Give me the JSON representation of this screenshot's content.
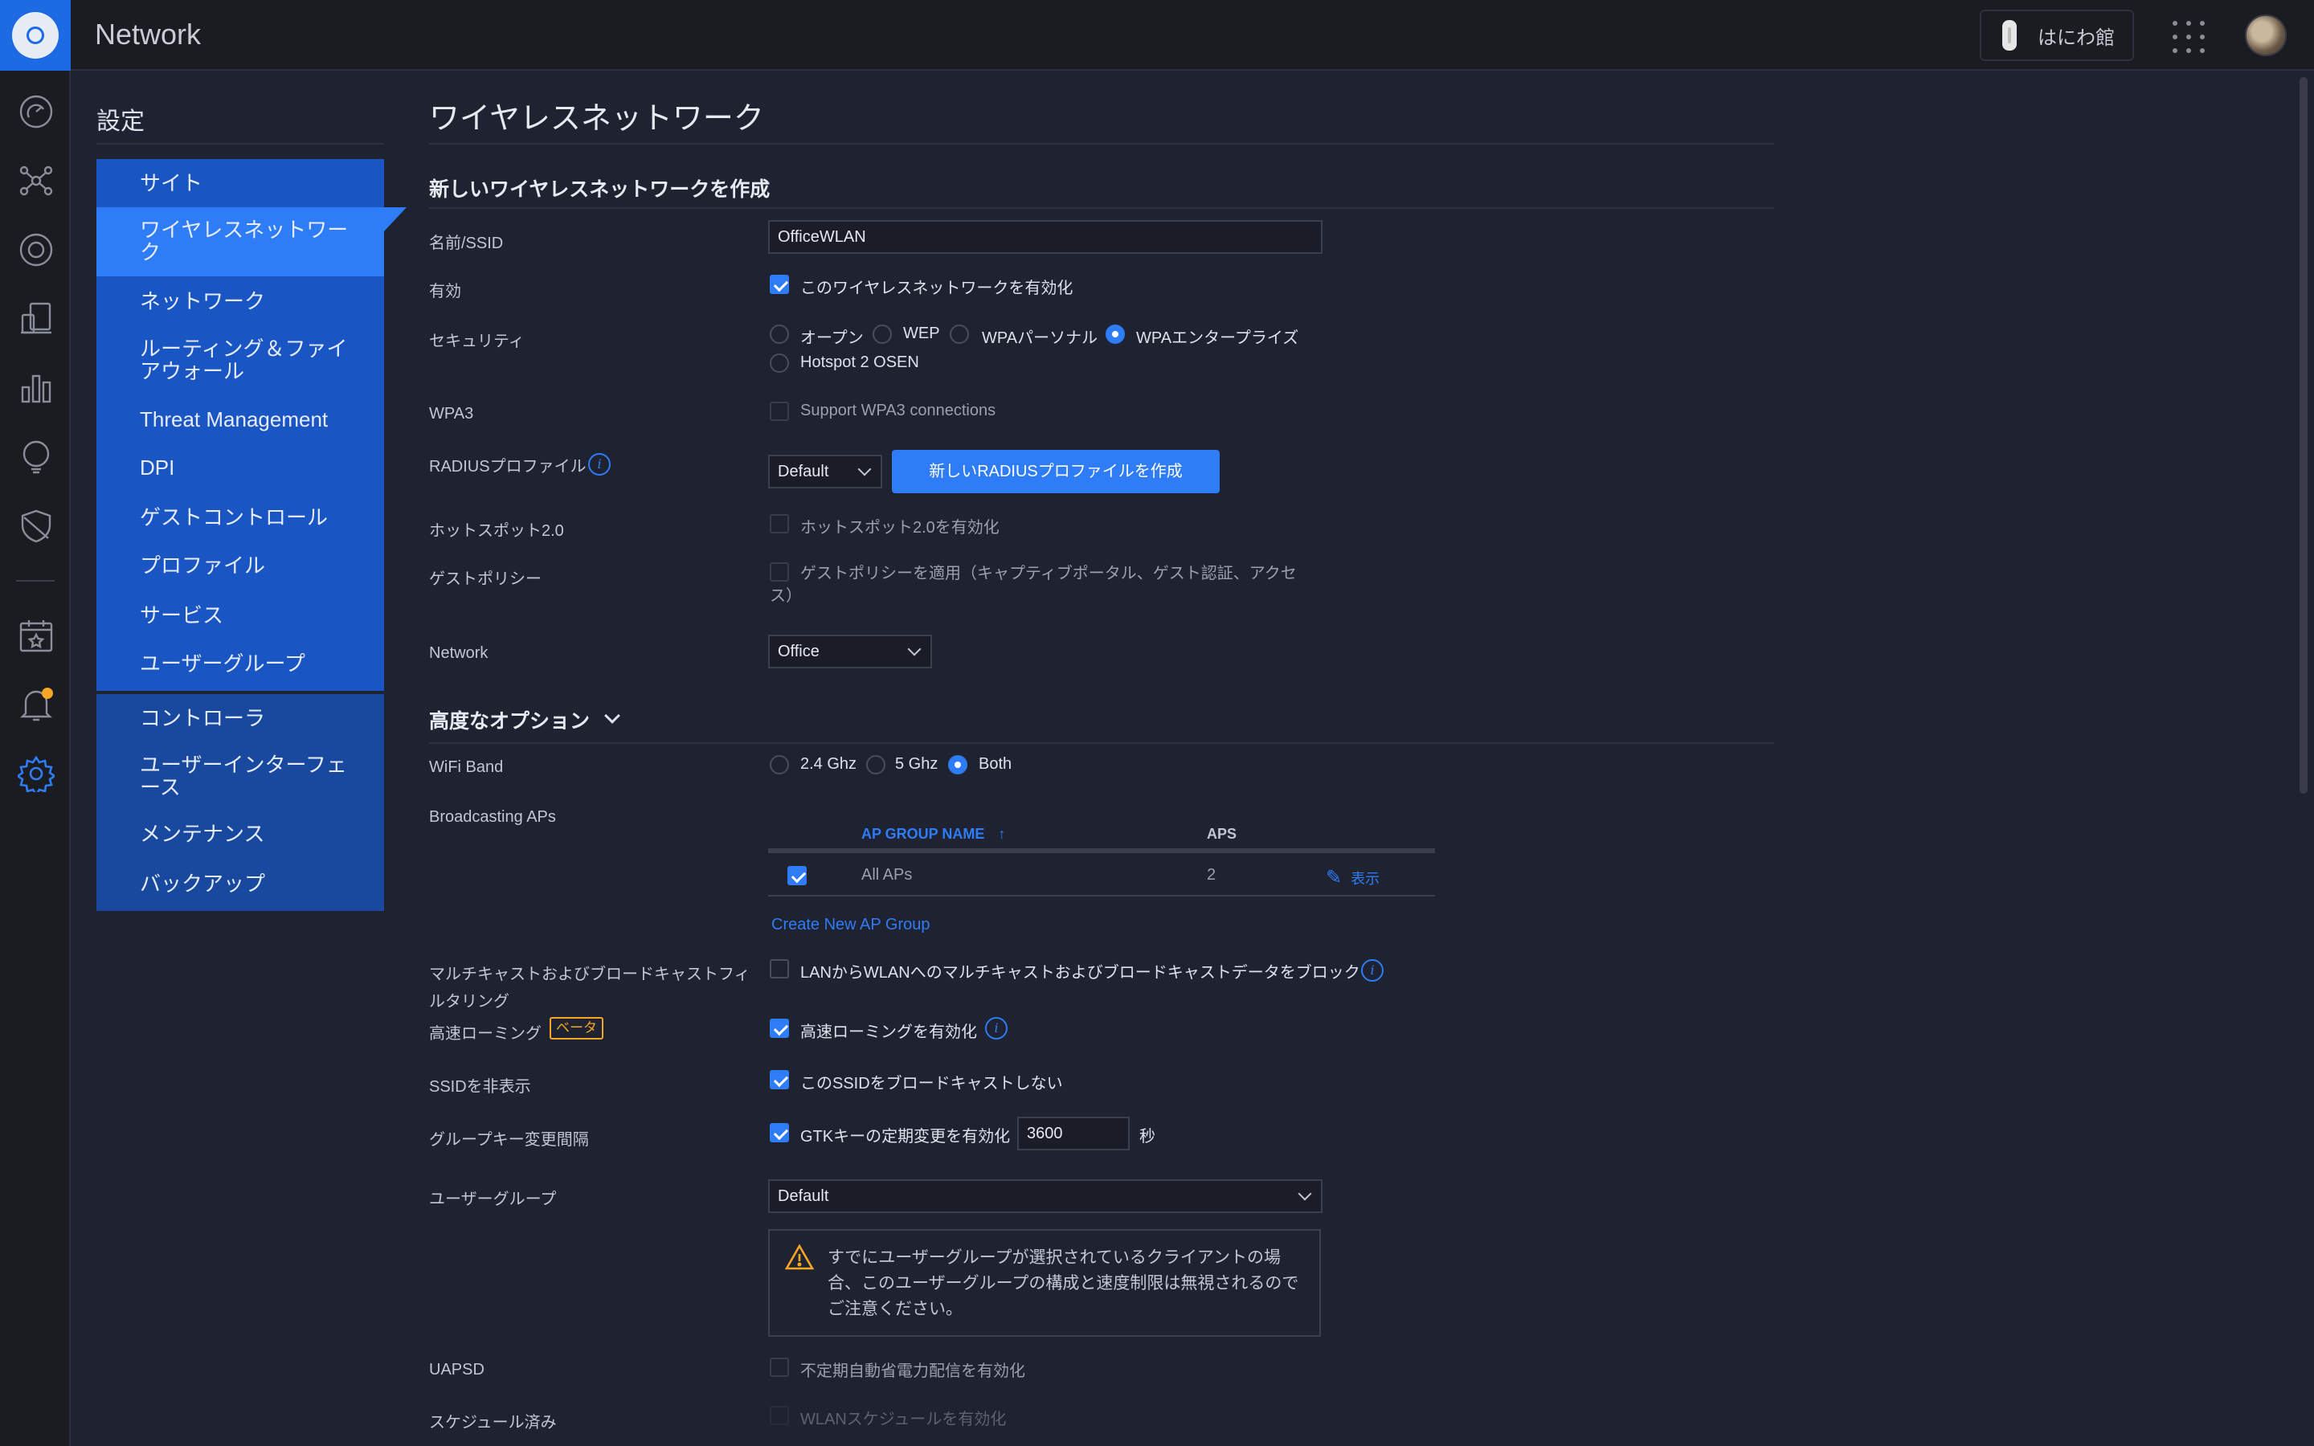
{
  "header": {
    "app_title": "Network",
    "site_name": "はにわ館",
    "icons": [
      "ubiquiti-logo-icon",
      "device-icon",
      "apps-grid-icon",
      "user-avatar"
    ]
  },
  "rail": {
    "items": [
      {
        "name": "dashboard-icon"
      },
      {
        "name": "topology-icon"
      },
      {
        "name": "devices-icon"
      },
      {
        "name": "clients-icon"
      },
      {
        "name": "statistics-icon"
      },
      {
        "name": "insights-icon"
      },
      {
        "name": "threat-shield-icon"
      },
      {
        "name": "events-calendar-icon"
      },
      {
        "name": "alerts-bell-icon"
      },
      {
        "name": "settings-gear-icon"
      }
    ]
  },
  "settings_nav": {
    "title": "設定",
    "group1": [
      {
        "label": "サイト"
      },
      {
        "label": "ワイヤレスネットワーク",
        "active": true
      },
      {
        "label": "ネットワーク"
      },
      {
        "label": "ルーティング＆ファイアウォール"
      },
      {
        "label": "Threat Management"
      },
      {
        "label": "DPI"
      },
      {
        "label": "ゲストコントロール"
      },
      {
        "label": "プロファイル"
      },
      {
        "label": "サービス"
      },
      {
        "label": "ユーザーグループ"
      }
    ],
    "group2": [
      {
        "label": "コントローラ"
      },
      {
        "label": "ユーザーインターフェース"
      },
      {
        "label": "メンテナンス"
      },
      {
        "label": "バックアップ"
      }
    ]
  },
  "main": {
    "page_title": "ワイヤレスネットワーク",
    "section_create": "新しいワイヤレスネットワークを作成",
    "name_label": "名前/SSID",
    "name_value": "OfficeWLAN",
    "enabled_label": "有効",
    "enabled_checkbox": "このワイヤレスネットワークを有効化",
    "security_label": "セキュリティ",
    "security_options": [
      "オープン",
      "WEP",
      "WPAパーソナル",
      "WPAエンタープライズ",
      "Hotspot 2 OSEN"
    ],
    "security_selected": "WPAエンタープライズ",
    "wpa3_label": "WPA3",
    "wpa3_checkbox": "Support WPA3 connections",
    "radius_label": "RADIUSプロファイル",
    "radius_value": "Default",
    "radius_button": "新しいRADIUSプロファイルを作成",
    "hotspot_label": "ホットスポット2.0",
    "hotspot_checkbox": "ホットスポット2.0を有効化",
    "guest_label": "ゲストポリシー",
    "guest_checkbox": "ゲストポリシーを適用（キャプティブポータル、ゲスト認証、アクセス）",
    "network_label": "Network",
    "network_value": "Office",
    "advanced_title": "高度なオプション",
    "wifi_band_label": "WiFi Band",
    "wifi_band_options": [
      "2.4 Ghz",
      "5 Ghz",
      "Both"
    ],
    "wifi_band_selected": "Both",
    "broadcasting_label": "Broadcasting APs",
    "ap_table": {
      "headers": [
        "AP GROUP NAME",
        "APS"
      ],
      "rows": [
        {
          "name": "All APs",
          "aps": "2",
          "action": "表示",
          "checked": true
        }
      ]
    },
    "create_ap_group": "Create New AP Group",
    "multicast_label": "マルチキャストおよびブロードキャストフィルタリング",
    "multicast_checkbox": "LANからWLANへのマルチキャストおよびブロードキャストデータをブロック",
    "fast_roaming_label": "高速ローミング",
    "beta_badge": "ベータ",
    "fast_roaming_checkbox": "高速ローミングを有効化",
    "hide_ssid_label": "SSIDを非表示",
    "hide_ssid_checkbox": "このSSIDをブロードキャストしない",
    "gtk_label": "グループキー変更間隔",
    "gtk_checkbox": "GTKキーの定期変更を有効化",
    "gtk_value": "3600",
    "gtk_unit": "秒",
    "user_group_label": "ユーザーグループ",
    "user_group_value": "Default",
    "warning_text": "すでにユーザーグループが選択されているクライアントの場合、このユーザーグループの構成と速度制限は無視されるのでご注意ください。",
    "uapsd_label": "UAPSD",
    "uapsd_checkbox": "不定期自動省電力配信を有効化",
    "schedule_label": "スケジュール済み",
    "schedule_checkbox": "WLANスケジュールを有効化"
  },
  "colors": {
    "accent": "#2e7cf6",
    "nav_blue": "#1a55c4",
    "background": "#1f2231",
    "warning": "#f5a623"
  }
}
